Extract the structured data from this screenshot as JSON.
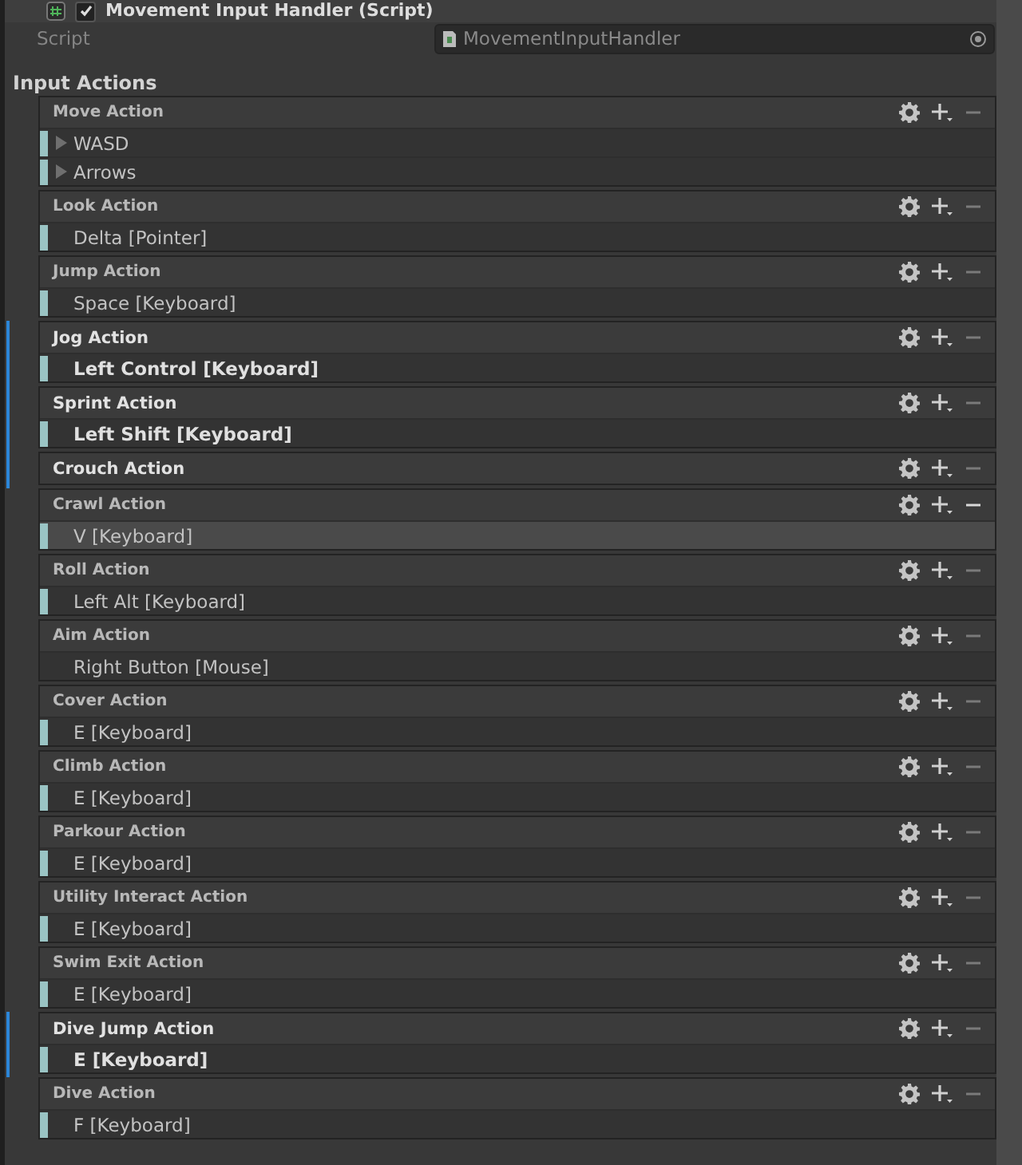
{
  "component": {
    "title": "Movement Input Handler (Script)",
    "enabled": true
  },
  "script_field": {
    "label": "Script",
    "value": "MovementInputHandler"
  },
  "section_title": "Input Actions",
  "actions": [
    {
      "name": "Move Action",
      "overridden": false,
      "remove_enabled": false,
      "bindings": [
        {
          "kind": "composite",
          "text": "WASD",
          "selected": false,
          "indicator": true
        },
        {
          "kind": "composite",
          "text": "Arrows",
          "selected": false,
          "indicator": true
        }
      ]
    },
    {
      "name": "Look Action",
      "overridden": false,
      "remove_enabled": false,
      "bindings": [
        {
          "kind": "binding",
          "text": "Delta [Pointer]",
          "selected": false,
          "indicator": true
        }
      ]
    },
    {
      "name": "Jump Action",
      "overridden": false,
      "remove_enabled": false,
      "bindings": [
        {
          "kind": "binding",
          "text": "Space [Keyboard]",
          "selected": false,
          "indicator": true
        }
      ]
    },
    {
      "name": "Jog Action",
      "overridden": true,
      "remove_enabled": false,
      "bindings": [
        {
          "kind": "binding",
          "text": "Left Control [Keyboard]",
          "selected": false,
          "indicator": true
        }
      ]
    },
    {
      "name": "Sprint Action",
      "overridden": true,
      "remove_enabled": false,
      "bindings": [
        {
          "kind": "binding",
          "text": "Left Shift [Keyboard]",
          "selected": false,
          "indicator": true
        }
      ]
    },
    {
      "name": "Crouch Action",
      "overridden": true,
      "remove_enabled": false
    },
    {
      "name": "Crawl Action",
      "overridden": false,
      "remove_enabled": true,
      "bindings": [
        {
          "kind": "binding",
          "text": "V [Keyboard]",
          "selected": true,
          "indicator": true
        }
      ]
    },
    {
      "name": "Roll Action",
      "overridden": false,
      "remove_enabled": false,
      "bindings": [
        {
          "kind": "binding",
          "text": "Left Alt [Keyboard]",
          "selected": false,
          "indicator": true
        }
      ]
    },
    {
      "name": "Aim Action",
      "overridden": false,
      "remove_enabled": false,
      "bindings": [
        {
          "kind": "binding",
          "text": "Right Button [Mouse]",
          "selected": false,
          "indicator": false
        }
      ]
    },
    {
      "name": "Cover Action",
      "overridden": false,
      "remove_enabled": false,
      "bindings": [
        {
          "kind": "binding",
          "text": "E [Keyboard]",
          "selected": false,
          "indicator": true
        }
      ]
    },
    {
      "name": "Climb Action",
      "overridden": false,
      "remove_enabled": false,
      "bindings": [
        {
          "kind": "binding",
          "text": "E [Keyboard]",
          "selected": false,
          "indicator": true
        }
      ]
    },
    {
      "name": "Parkour Action",
      "overridden": false,
      "remove_enabled": false,
      "bindings": [
        {
          "kind": "binding",
          "text": "E [Keyboard]",
          "selected": false,
          "indicator": true
        }
      ]
    },
    {
      "name": "Utility Interact Action",
      "overridden": false,
      "remove_enabled": false,
      "bindings": [
        {
          "kind": "binding",
          "text": "E [Keyboard]",
          "selected": false,
          "indicator": true
        }
      ]
    },
    {
      "name": "Swim Exit Action",
      "overridden": false,
      "remove_enabled": false,
      "bindings": [
        {
          "kind": "binding",
          "text": "E [Keyboard]",
          "selected": false,
          "indicator": true
        }
      ]
    },
    {
      "name": "Dive Jump Action",
      "overridden": true,
      "remove_enabled": false,
      "bindings": [
        {
          "kind": "binding",
          "text": "E [Keyboard]",
          "selected": false,
          "indicator": true
        }
      ]
    },
    {
      "name": "Dive Action",
      "overridden": false,
      "remove_enabled": false,
      "bindings": [
        {
          "kind": "binding",
          "text": "F [Keyboard]",
          "selected": false,
          "indicator": true
        }
      ]
    }
  ]
}
